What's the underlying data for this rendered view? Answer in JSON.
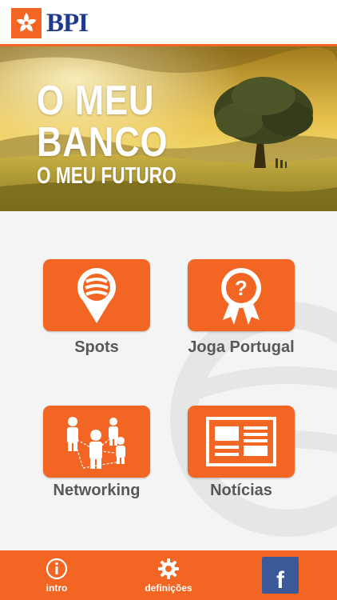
{
  "header": {
    "logo_text": "BPI",
    "logo_icon": "bpi-star-logo-icon",
    "accent_color": "#f26522",
    "brand_blue": "#1f3a8f"
  },
  "banner": {
    "line1": "O MEU",
    "line2": "BANCO",
    "line3": "O MEU FUTURO"
  },
  "tiles": [
    {
      "label": "Spots",
      "icon": "location-pin-icon"
    },
    {
      "label": "Joga Portugal",
      "icon": "award-ribbon-question-icon"
    },
    {
      "label": "Networking",
      "icon": "people-network-icon"
    },
    {
      "label": "Notícias",
      "icon": "newspaper-icon"
    }
  ],
  "bottom_bar": {
    "intro_label": "intro",
    "definicoes_label": "definições",
    "facebook_letter": "f",
    "facebook_color": "#3b5998"
  }
}
